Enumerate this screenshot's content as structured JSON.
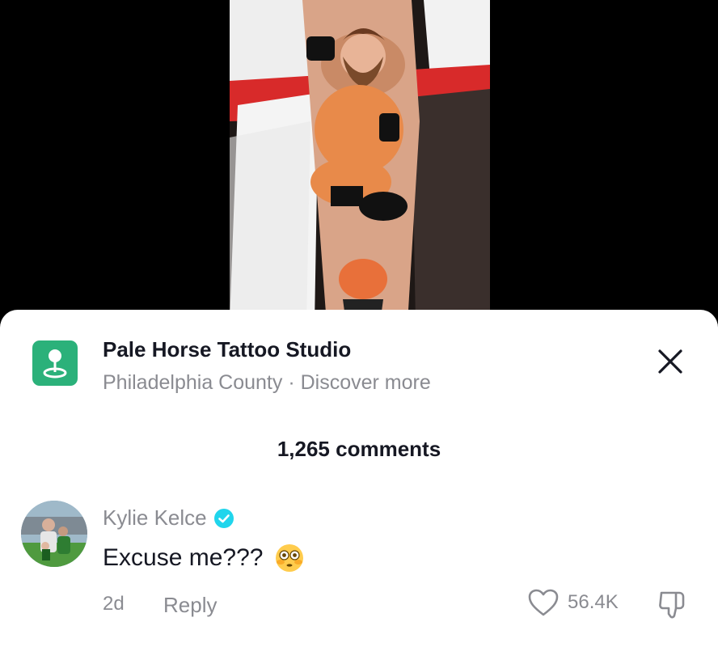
{
  "location": {
    "name": "Pale Horse Tattoo Studio",
    "subtitle": "Philadelphia County · Discover more",
    "badge_color": "#2bb17a",
    "icon": "map-pin-icon"
  },
  "comments_header": "1,265 comments",
  "comment": {
    "author": "Kylie Kelce",
    "verified": true,
    "verified_color": "#20d5ec",
    "text": "Excuse me???",
    "emoji": "flushed-face",
    "time": "2d",
    "reply_label": "Reply",
    "like_count": "56.4K"
  },
  "icons": {
    "close": "close-icon",
    "like": "heart-icon",
    "dislike": "thumbs-down-icon"
  },
  "colors": {
    "text_primary": "#161823",
    "text_secondary": "#8a8b91"
  }
}
